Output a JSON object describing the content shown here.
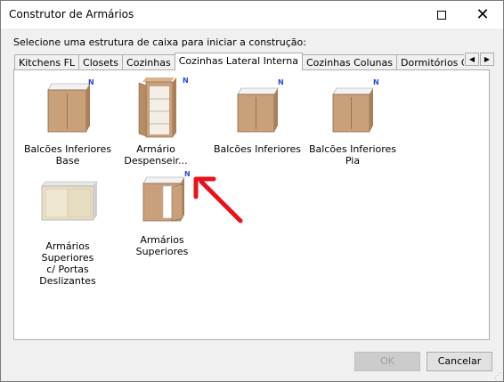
{
  "window": {
    "title": "Construtor de Armários"
  },
  "prompt": "Selecione uma estrutura de caixa para iniciar a construção:",
  "tabs": [
    {
      "label": "Kitchens FL"
    },
    {
      "label": "Closets"
    },
    {
      "label": "Cozinhas"
    },
    {
      "label": "Cozinhas Lateral Interna",
      "active": true
    },
    {
      "label": "Cozinhas Colunas"
    },
    {
      "label": "Dormitórios Colunas"
    }
  ],
  "items": [
    {
      "label_line1": "Balcões Inferiores",
      "label_line2": "Base",
      "badge": "N",
      "icon": "base-cabinet-icon"
    },
    {
      "label_line1": "Armário Despenseir...",
      "label_line2": "",
      "badge": "N",
      "icon": "pantry-cabinet-icon"
    },
    {
      "label_line1": "Balcões Inferiores",
      "label_line2": "",
      "badge": "N",
      "icon": "lower-cabinet-icon"
    },
    {
      "label_line1": "Balcões Inferiores Pia",
      "label_line2": "",
      "badge": "N",
      "icon": "sink-cabinet-icon"
    },
    {
      "label_line1": "Armários Superiores",
      "label_line2": "c/ Portas Deslizantes",
      "badge": "",
      "icon": "sliding-door-cabinet-icon"
    },
    {
      "label_line1": "Armários Superiores",
      "label_line2": "",
      "badge": "N",
      "icon": "upper-cabinet-icon"
    }
  ],
  "buttons": {
    "ok": "OK",
    "cancel": "Cancelar"
  },
  "colors": {
    "wood": "#c9a07a",
    "annotation_arrow": "#e8121b",
    "badge": "#2a4bd7"
  }
}
